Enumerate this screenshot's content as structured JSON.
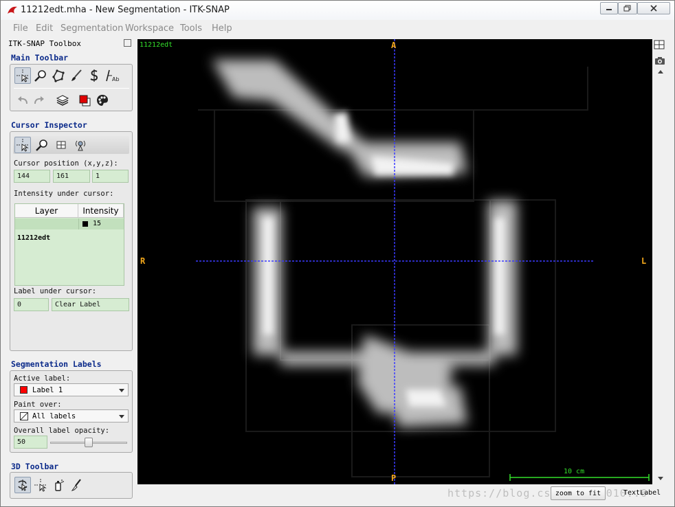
{
  "window": {
    "title": "11212edt.mha - New Segmentation - ITK-SNAP",
    "controls": {
      "minimize": "minimize-icon",
      "maximize": "maximize-icon",
      "close": "close-icon"
    }
  },
  "menubar": [
    "File",
    "Edit",
    "Segmentation",
    "Workspace",
    "Tools",
    "Help"
  ],
  "toolbox": {
    "title": "ITK-SNAP Toolbox",
    "main_toolbar": {
      "title": "Main Toolbar",
      "tools": [
        "crosshair-tool-icon",
        "zoom-tool-icon",
        "polygon-tool-icon",
        "paintbrush-tool-icon",
        "snake-tool-icon",
        "annotation-tool-icon"
      ],
      "actions": [
        "undo-icon",
        "redo-icon",
        "layers-icon",
        "label-color-icon",
        "palette-icon"
      ]
    },
    "cursor_inspector": {
      "title": "Cursor Inspector",
      "tabs": [
        "crosshair-tab-icon",
        "zoom-tab-icon",
        "grid-tab-icon",
        "synchronize-tab-icon"
      ],
      "position_label": "Cursor position (x,y,z):",
      "position": {
        "x": "144",
        "y": "161",
        "z": "1"
      },
      "intensity_label": "Intensity under cursor:",
      "table": {
        "headers": [
          "Layer",
          "Intensity"
        ],
        "rows": [
          {
            "layer": "11212edt",
            "intensity": "15",
            "swatch": "#000000"
          }
        ]
      },
      "label_under_cursor": "Label under cursor:",
      "label_id": "0",
      "label_name": "Clear Label"
    },
    "segmentation_labels": {
      "title": "Segmentation Labels",
      "active_label_caption": "Active label:",
      "active_label": "Label 1",
      "active_label_color": "#ff0000",
      "paint_over_caption": "Paint over:",
      "paint_over": "All labels",
      "opacity_caption": "Overall label opacity:",
      "opacity_value": "50"
    },
    "toolbar_3d": {
      "title": "3D Toolbar",
      "tools": [
        "rotate-3d-icon",
        "crosshair-3d-icon",
        "spray-paint-icon",
        "scalpel-icon"
      ]
    }
  },
  "viewer": {
    "layer_name": "11212edt",
    "orientation": {
      "top": "A",
      "bottom": "P",
      "left": "R",
      "right": "L"
    },
    "scalebar_label": "10 cm",
    "crosshair_color": "#3a3aff",
    "orientation_color": "#f4a81b",
    "overlay_color": "#34e02b"
  },
  "right_panel": {
    "icons": [
      "layout-icon",
      "screenshot-icon"
    ]
  },
  "bottom": {
    "zoom_to_fit": "zoom to fit",
    "text_label": "TextLabel",
    "watermark": "https://blog.csdn.net/u010..6"
  }
}
